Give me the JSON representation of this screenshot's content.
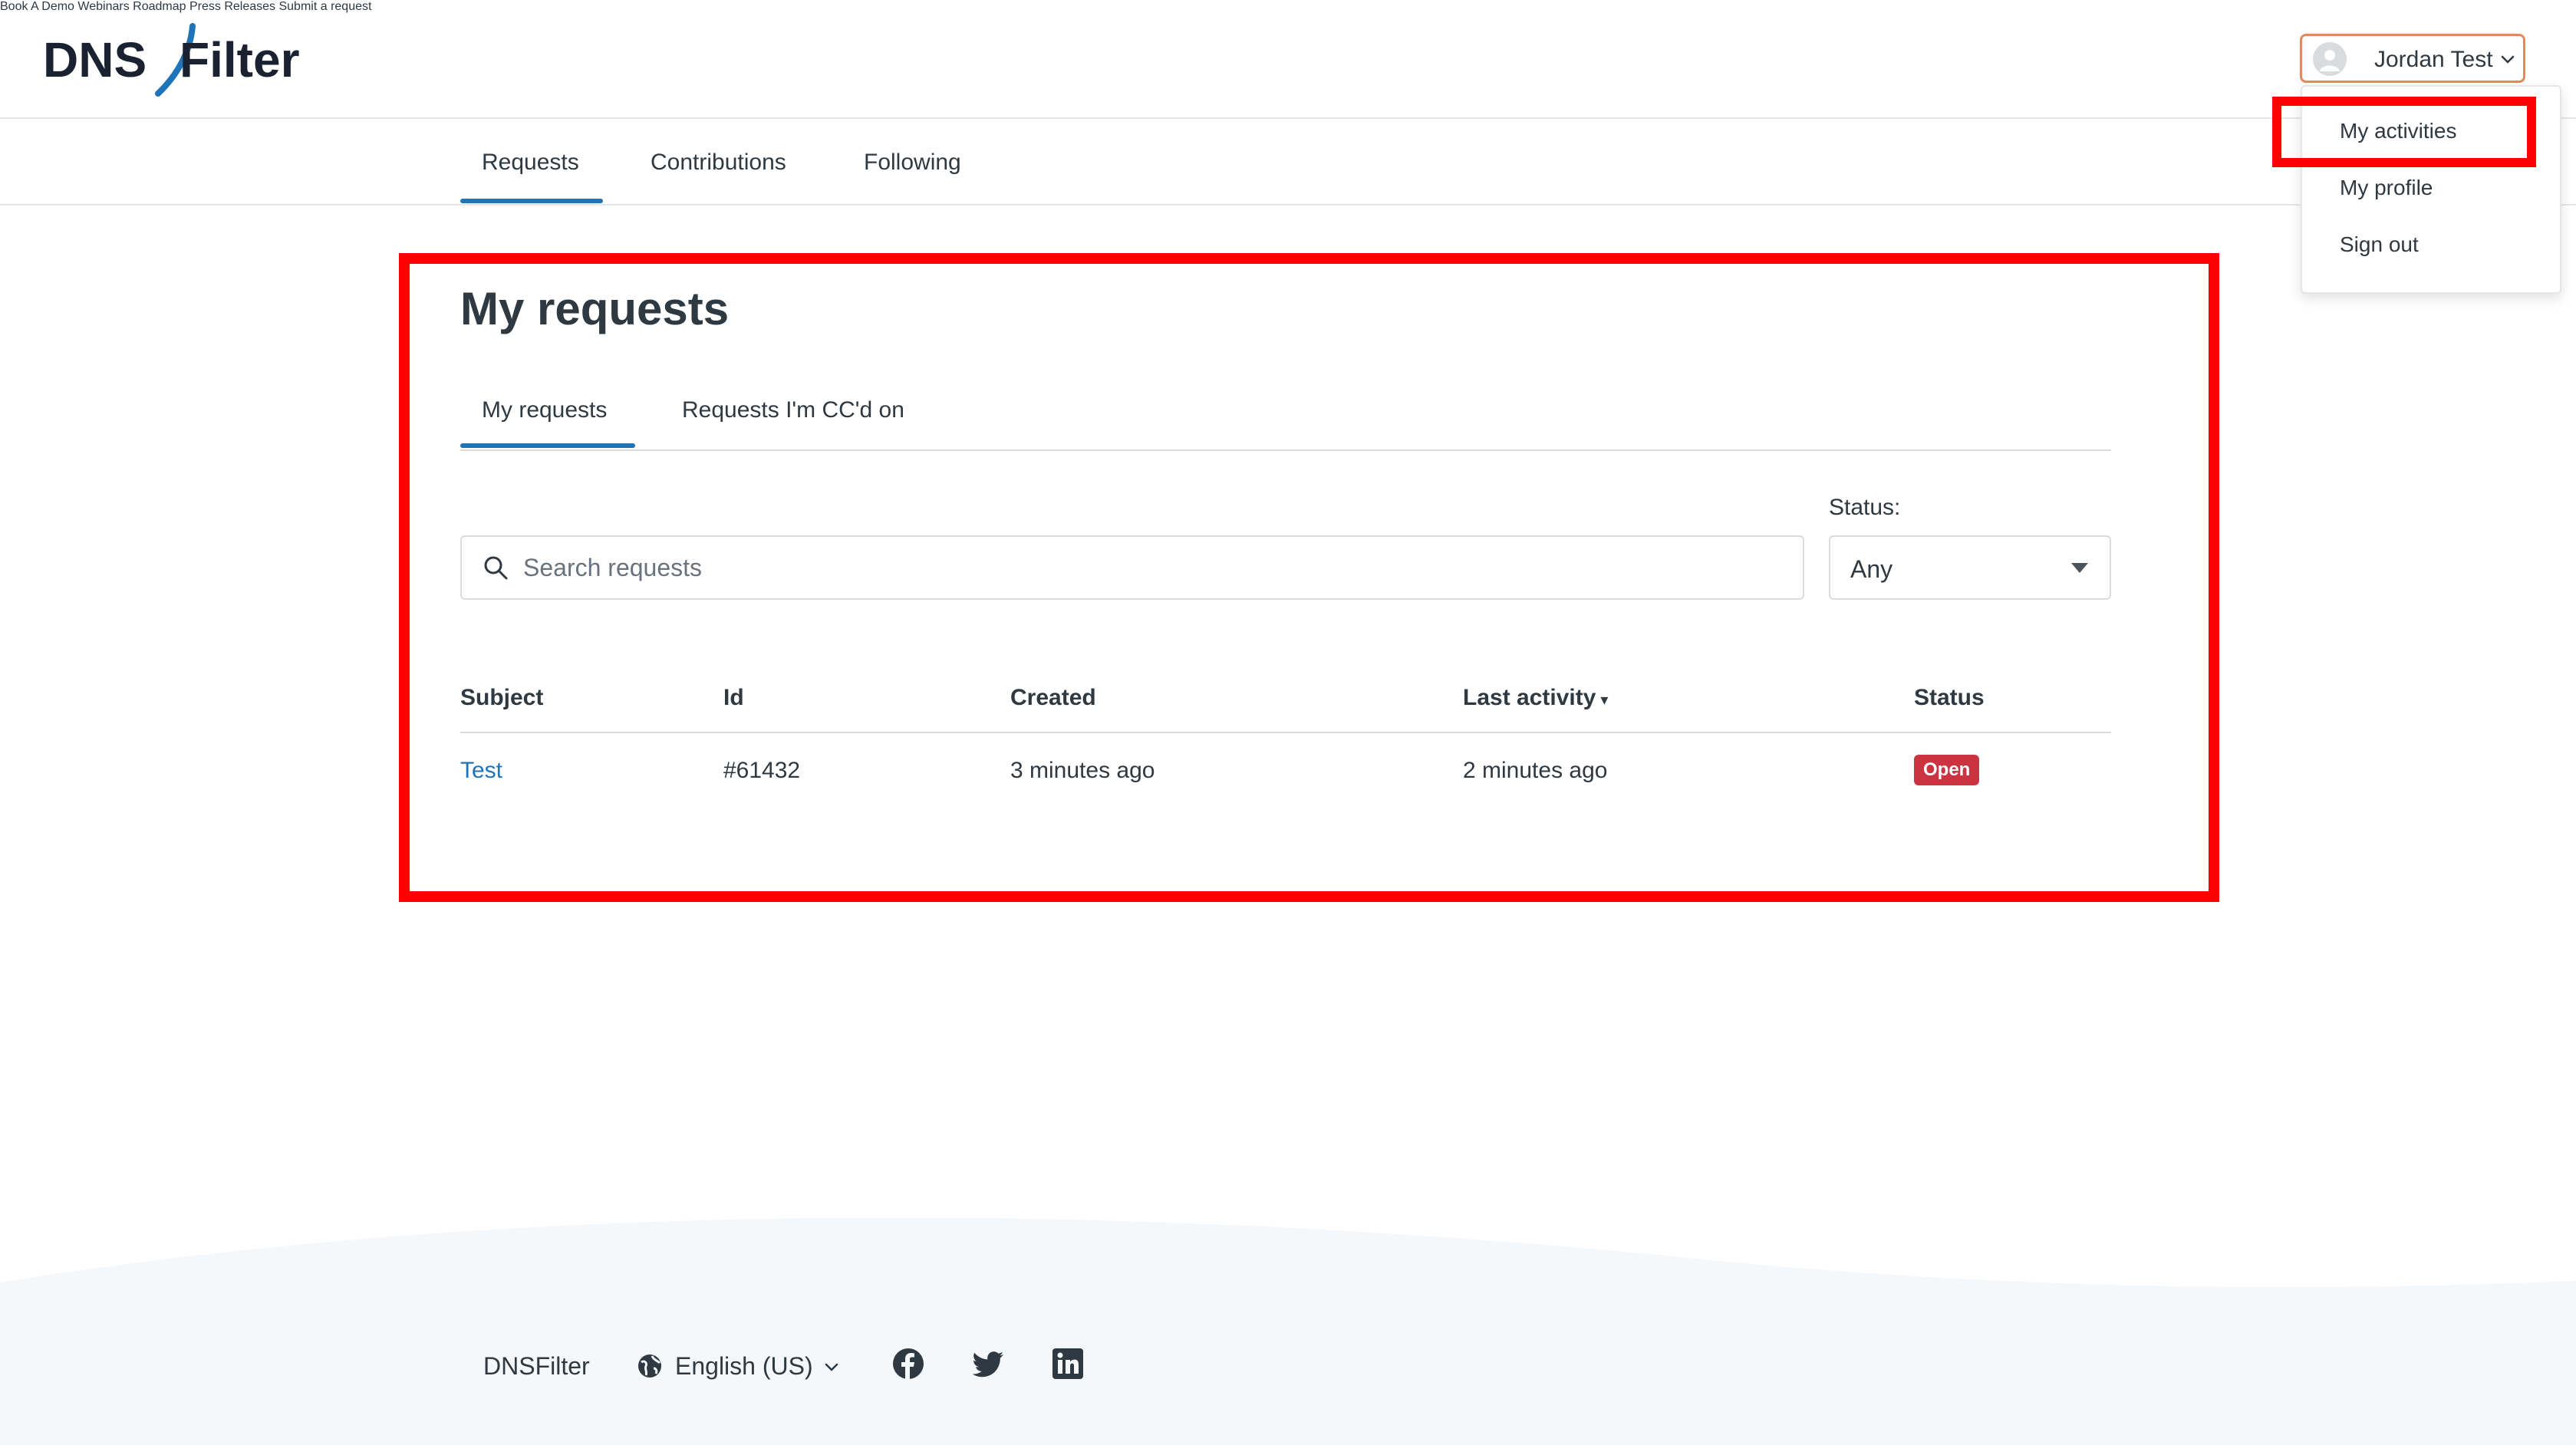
{
  "brand": {
    "logo_text_left": "DNS",
    "logo_text_right": "Filter"
  },
  "topnav": {
    "links": [
      "Book A Demo",
      "Webinars",
      "Roadmap",
      "Press Releases",
      "Submit a request"
    ],
    "user_name": "Jordan Test"
  },
  "user_menu": {
    "items": [
      "My activities",
      "My profile",
      "Sign out"
    ]
  },
  "subnav": {
    "tabs": [
      "Requests",
      "Contributions",
      "Following"
    ],
    "active": "Requests"
  },
  "main": {
    "title": "My requests",
    "tabs": [
      "My requests",
      "Requests I'm CC'd on"
    ],
    "active_tab": "My requests",
    "search": {
      "placeholder": "Search requests",
      "value": ""
    },
    "status_filter": {
      "label": "Status:",
      "selected": "Any"
    },
    "table": {
      "columns": [
        "Subject",
        "Id",
        "Created",
        "Last activity",
        "Status"
      ],
      "sort_indicator": "▾",
      "rows": [
        {
          "subject": "Test",
          "id": "#61432",
          "created": "3 minutes ago",
          "last_activity": "2 minutes ago",
          "status": "Open"
        }
      ]
    }
  },
  "footer": {
    "brand": "DNSFilter",
    "language": "English (US)"
  },
  "colors": {
    "accent": "#1f73b7",
    "highlight": "#ff0000",
    "status_open": "#cc3340",
    "user_button_border": "#e3895c",
    "footer_bg": "#f5f8fb"
  },
  "icons": {
    "search": "search-icon",
    "globe": "globe-icon",
    "facebook": "facebook-icon",
    "twitter": "twitter-icon",
    "linkedin": "linkedin-icon",
    "avatar": "avatar-icon",
    "chevron": "chevron-down-icon"
  }
}
